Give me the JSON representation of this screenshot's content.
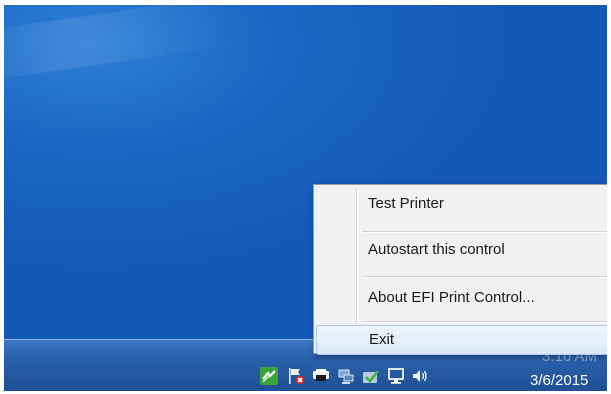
{
  "context_menu": {
    "items": [
      {
        "label": "Test Printer"
      },
      {
        "label": "Autostart this control"
      },
      {
        "label": "About EFI Print Control..."
      },
      {
        "label": "Exit",
        "highlighted": true
      }
    ]
  },
  "tray": {
    "icons": [
      "efi-print-control-icon",
      "action-center-flag-icon",
      "printer-icon",
      "network-icon",
      "security-check-icon",
      "display-icon",
      "volume-icon"
    ]
  },
  "clock": {
    "time": "3:16 AM",
    "date": "3/6/2015"
  },
  "colors": {
    "desktop": "#1b66c4",
    "taskbar": "#2a62ad",
    "menu_background": "#f1f1f1",
    "menu_highlight": "#dbe9f8"
  }
}
